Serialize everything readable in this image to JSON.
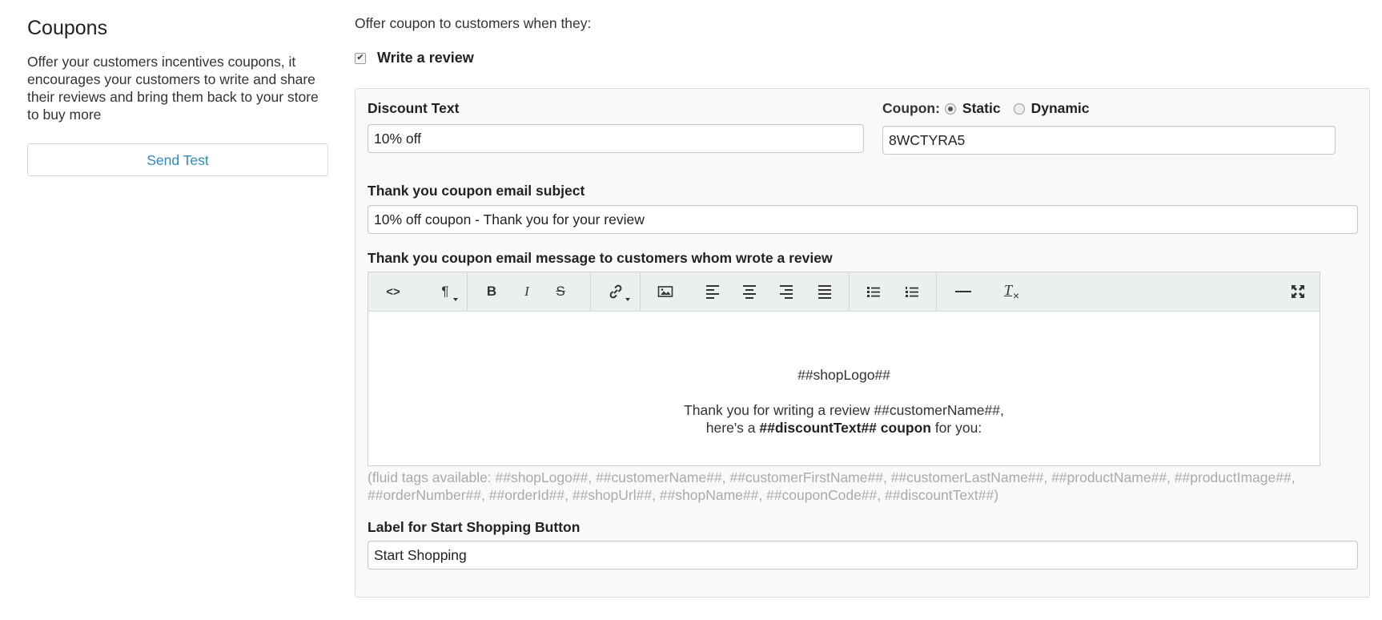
{
  "sidebar": {
    "title": "Coupons",
    "description": "Offer your customers incentives coupons, it encourages your customers to write and share their reviews and bring them back to your store to buy more",
    "send_test_label": "Send Test"
  },
  "offer": {
    "intro": "Offer coupon to customers when they:",
    "write_review_label": "Write a review",
    "write_review_checked": true
  },
  "discount": {
    "label": "Discount Text",
    "value": "10% off"
  },
  "coupon": {
    "label": "Coupon:",
    "options": [
      "Static",
      "Dynamic"
    ],
    "selected": "Static",
    "code": "8WCTYRA5"
  },
  "subject": {
    "label": "Thank you coupon email subject",
    "value": "10% off coupon - Thank you for your review"
  },
  "message": {
    "label": "Thank you coupon email message to customers whom wrote a review",
    "toolbar": {
      "code": "<>",
      "paragraph": "¶",
      "bold": "B",
      "italic": "I",
      "strike": "S",
      "clear": "T"
    },
    "body": {
      "logo_line": "##shopLogo##",
      "thank_line": "Thank you for writing a review ##customerName##,",
      "pre": "here's a ",
      "bold": "##discountText## coupon",
      "post": " for you:"
    },
    "hint": "(fluid tags available: ##shopLogo##, ##customerName##, ##customerFirstName##, ##customerLastName##, ##productName##, ##productImage##, ##orderNumber##, ##orderId##, ##shopUrl##, ##shopName##, ##couponCode##, ##discountText##)"
  },
  "start_shopping": {
    "label": "Label for Start Shopping Button",
    "value": "Start Shopping"
  }
}
